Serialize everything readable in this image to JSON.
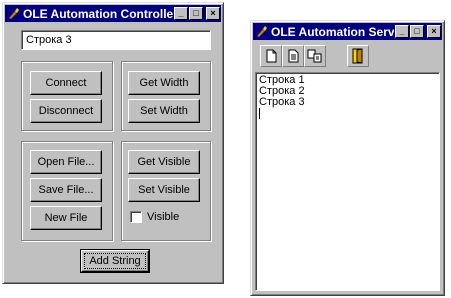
{
  "controller": {
    "title": "OLE Automation Controller",
    "edit_value": "Строка 3",
    "buttons": {
      "connect": "Connect",
      "disconnect": "Disconnect",
      "get_width": "Get Width",
      "set_width": "Set Width",
      "open_file": "Open File...",
      "save_file": "Save File...",
      "new_file": "New File",
      "get_visible": "Get Visible",
      "set_visible": "Set Visible",
      "add_string": "Add String"
    },
    "visible_checkbox": {
      "label": "Visible",
      "checked": false
    }
  },
  "server": {
    "title": "OLE Automation Server",
    "toolbar": [
      "new-file-icon",
      "open-file-icon",
      "save-file-icon",
      "exit-door-icon"
    ],
    "lines": [
      "Строка 1",
      "Строка 2",
      "Строка 3"
    ]
  },
  "titlebar_buttons": {
    "minimize": "_",
    "maximize": "□",
    "close": "×"
  },
  "colors": {
    "face": "#c0c0c0",
    "title_active": "#000080",
    "title_text": "#ffffff"
  }
}
